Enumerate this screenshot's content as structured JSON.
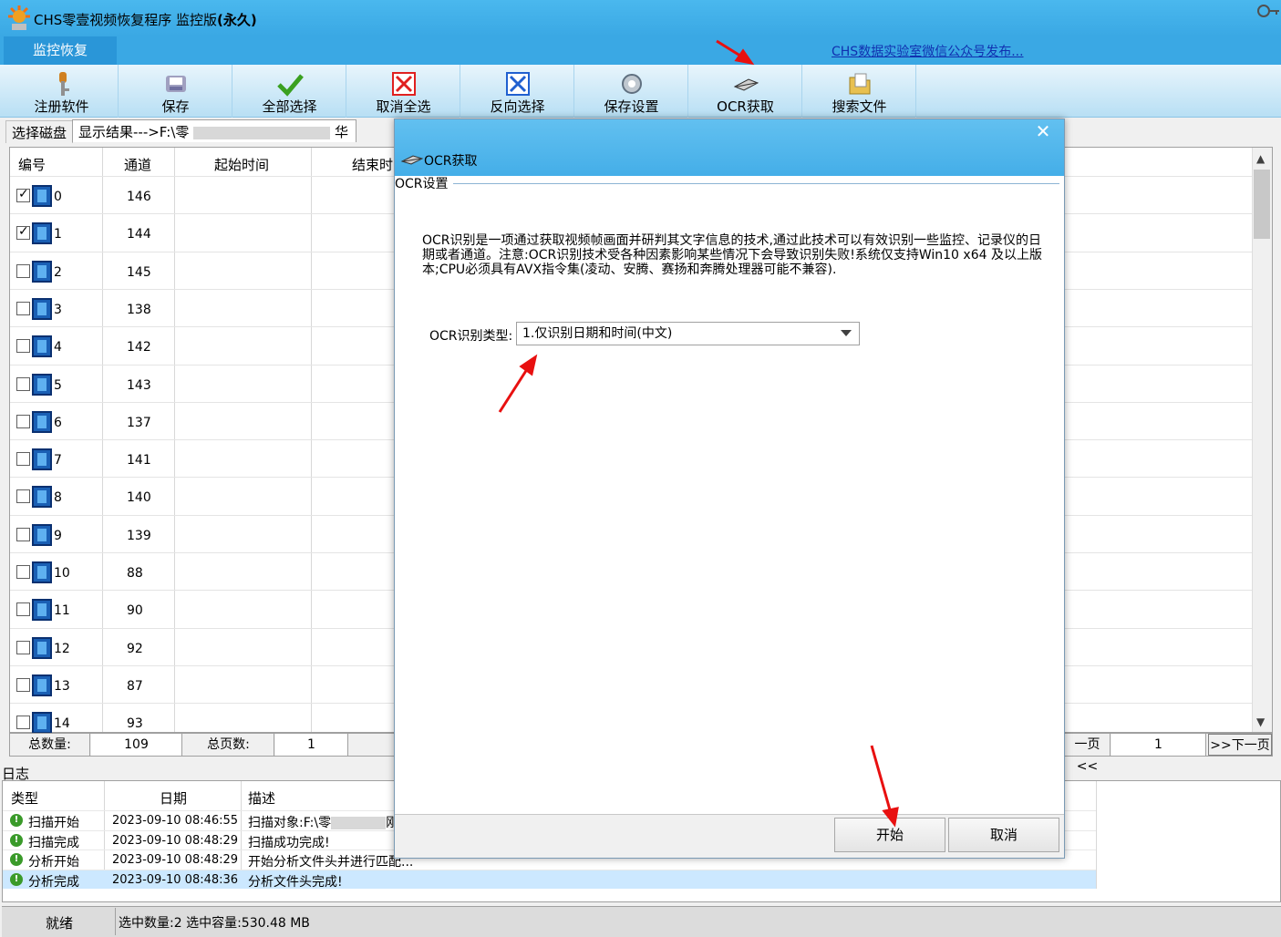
{
  "app": {
    "title_prefix": "CHS零壹视频恢复程序 监控版",
    "title_suffix": "(永久)",
    "tab_label": "监控恢复",
    "wechat_link": "CHS数据实验室微信公众号发布..."
  },
  "toolbar": [
    {
      "label": "注册软件",
      "icon": "key-icon"
    },
    {
      "label": "保存",
      "icon": "save-icon"
    },
    {
      "label": "全部选择",
      "icon": "check-icon"
    },
    {
      "label": "取消全选",
      "icon": "cancel-select-icon"
    },
    {
      "label": "反向选择",
      "icon": "invert-select-icon"
    },
    {
      "label": "保存设置",
      "icon": "settings-icon"
    },
    {
      "label": "OCR获取",
      "icon": "scanner-icon"
    },
    {
      "label": "搜索文件",
      "icon": "folder-icon"
    }
  ],
  "subtabs": {
    "disk": "选择磁盘",
    "results_prefix": "显示结果--->F:\\零",
    "results_suffix": "华"
  },
  "grid": {
    "headers": [
      "编号",
      "通道",
      "起始时间",
      "结束时"
    ],
    "rows": [
      {
        "id": "0",
        "channel": "146",
        "checked": true
      },
      {
        "id": "1",
        "channel": "144",
        "checked": true
      },
      {
        "id": "2",
        "channel": "145",
        "checked": false
      },
      {
        "id": "3",
        "channel": "138",
        "checked": false
      },
      {
        "id": "4",
        "channel": "142",
        "checked": false
      },
      {
        "id": "5",
        "channel": "143",
        "checked": false
      },
      {
        "id": "6",
        "channel": "137",
        "checked": false
      },
      {
        "id": "7",
        "channel": "141",
        "checked": false
      },
      {
        "id": "8",
        "channel": "140",
        "checked": false
      },
      {
        "id": "9",
        "channel": "139",
        "checked": false
      },
      {
        "id": "10",
        "channel": "88",
        "checked": false
      },
      {
        "id": "11",
        "channel": "90",
        "checked": false
      },
      {
        "id": "12",
        "channel": "92",
        "checked": false
      },
      {
        "id": "13",
        "channel": "87",
        "checked": false
      },
      {
        "id": "14",
        "channel": "93",
        "checked": false
      }
    ]
  },
  "pager": {
    "total_label": "总数量:",
    "total_value": "109",
    "pages_label": "总页数:",
    "pages_value": "1",
    "prev": "一页<<",
    "current": "1",
    "next": ">>下一页"
  },
  "log": {
    "title": "日志",
    "headers": [
      "类型",
      "日期",
      "描述"
    ],
    "rows": [
      {
        "type": "扫描开始",
        "date": "2023-09-10 08:46:55",
        "desc": "扫描对象:F:\\零",
        "desc_tail": "刚"
      },
      {
        "type": "扫描完成",
        "date": "2023-09-10 08:48:29",
        "desc": "扫描成功完成!",
        "desc_tail": ""
      },
      {
        "type": "分析开始",
        "date": "2023-09-10 08:48:29",
        "desc": "开始分析文件头并进行匹配...",
        "desc_tail": ""
      },
      {
        "type": "分析完成",
        "date": "2023-09-10 08:48:36",
        "desc": "分析文件头完成!",
        "desc_tail": ""
      }
    ]
  },
  "status": {
    "ready": "就绪",
    "selection": "选中数量:2 选中容量:530.48 MB"
  },
  "dialog": {
    "title": "OCR获取",
    "close": "✕",
    "section": "OCR设置",
    "description": "OCR识别是一项通过获取视频帧画面并研判其文字信息的技术,通过此技术可以有效识别一些监控、记录仪的日期或者通道。注意:OCR识别技术受各种因素影响某些情况下会导致识别失败!系统仅支持Win10 x64 及以上版本;CPU必须具有AVX指令集(凌动、安腾、赛扬和奔腾处理器可能不兼容).",
    "type_label": "OCR识别类型:",
    "type_value": "1.仅识别日期和时间(中文)",
    "start": "开始",
    "cancel": "取消"
  },
  "colors": {
    "title_bar": "#3aa8e4",
    "tab_active": "#2a96d8",
    "annotation_arrow": "#e81010",
    "log_selected": "#cce8ff"
  }
}
